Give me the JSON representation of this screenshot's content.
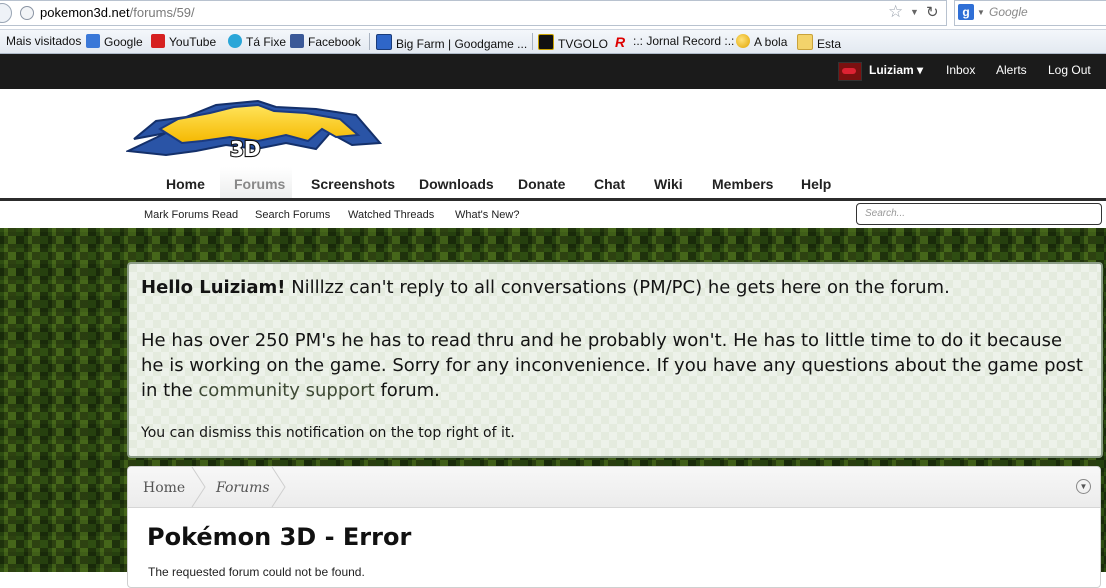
{
  "browser": {
    "url_host": "pokemon3d.net",
    "url_path": "/forums/59/",
    "search_placeholder": "Google",
    "bookmarks": [
      "Mais visitados",
      "Google",
      "YouTube",
      "Tá Fixe",
      "Facebook",
      "Big Farm | Goodgame ...",
      "TVGOLO",
      ":.: Jornal Record :.:",
      "A bola",
      "Esta"
    ]
  },
  "topbar": {
    "username": "Luiziam",
    "inbox": "Inbox",
    "alerts": "Alerts",
    "logout": "Log Out"
  },
  "logo_alt": "Pokémon 3D",
  "nav": {
    "tabs": [
      "Home",
      "Forums",
      "Screenshots",
      "Downloads",
      "Donate",
      "Chat",
      "Wiki",
      "Members",
      "Help"
    ],
    "active": "Forums"
  },
  "subnav": {
    "links": [
      "Mark Forums Read",
      "Search Forums",
      "Watched Threads",
      "What's New?"
    ],
    "search_placeholder": "Search..."
  },
  "notice": {
    "greeting": "Hello Luiziam!",
    "line1": " Nilllzz can't reply to all conversations (PM/PC) he gets here on the forum.",
    "para2_before": "He has over 250 PM's he has to read thru and he probably won't. He has to little time to do it because he is working on the game. Sorry for any inconvenience. If you have any questions about the game post in the ",
    "link_text": "community support",
    "para2_after": " forum.",
    "dismiss": "You can dismiss this notification on the top right of it."
  },
  "breadcrumb": [
    "Home",
    "Forums"
  ],
  "page_title": "Pokémon 3D - Error",
  "error_message": "The requested forum could not be found."
}
